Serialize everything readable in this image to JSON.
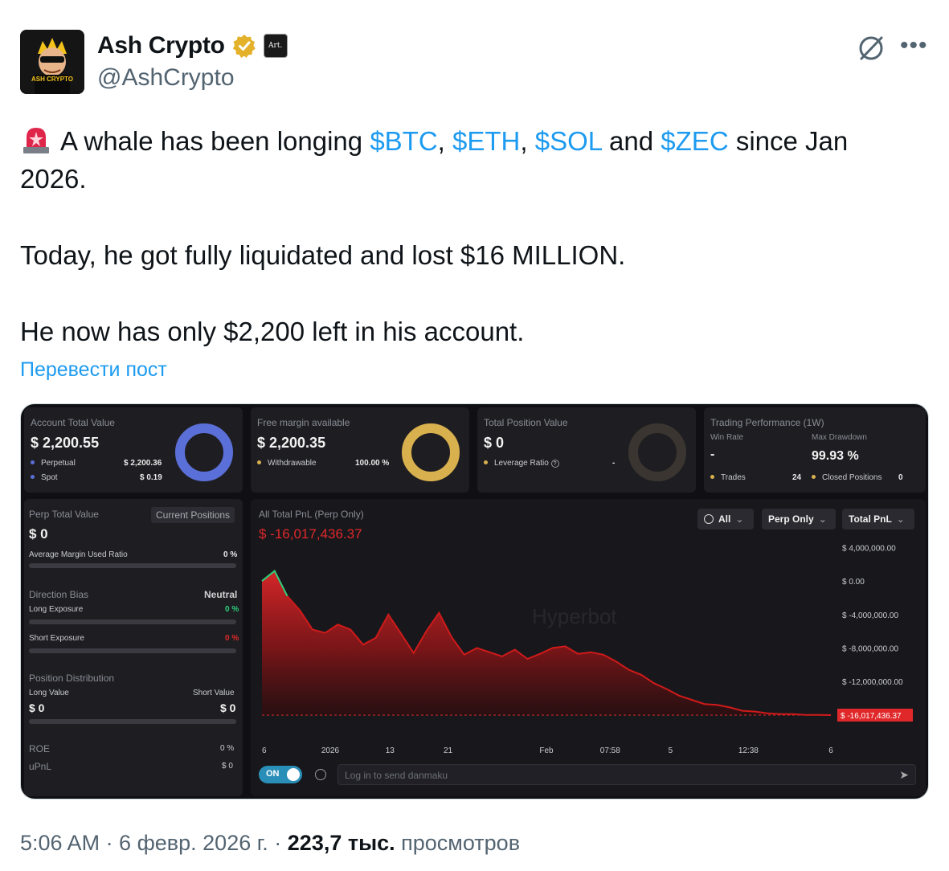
{
  "author": {
    "name": "Ash Crypto",
    "handle": "@AshCrypto",
    "avatar_text": "ASH CRYPTO",
    "affiliate_badge": "Art.",
    "verified_badge_icon": "verified-badge-icon"
  },
  "tweet": {
    "line1_prefix": "A whale has been longing ",
    "tag_btc": "$BTC",
    "sep1": ", ",
    "tag_eth": "$ETH",
    "sep2": ", ",
    "tag_sol": "$SOL",
    "and_text": " and ",
    "tag_zec": "$ZEC",
    "line1_suffix": " since Jan 2026.",
    "para2": "Today, he got fully liquidated and lost $16 MILLION.",
    "para3": "He now has only $2,200 left in his account.",
    "translate_link": "Перевести пост"
  },
  "dashboard": {
    "account": {
      "label": "Account Total Value",
      "value": "$ 2,200.55",
      "perp_label": "Perpetual",
      "perp_value": "$ 2,200.36",
      "spot_label": "Spot",
      "spot_value": "$ 0.19"
    },
    "margin": {
      "label": "Free margin available",
      "value": "$ 2,200.35",
      "withdrawable_label": "Withdrawable",
      "withdrawable_value": "100.00 %"
    },
    "position": {
      "label": "Total Position Value",
      "value": "$ 0",
      "leverage_label": "Leverage Ratio",
      "leverage_value": "-"
    },
    "performance": {
      "label": "Trading Performance (1W)",
      "win_rate_label": "Win Rate",
      "win_rate_value": "-",
      "max_dd_label": "Max Drawdown",
      "max_dd_value": "99.93 %",
      "trades_label": "Trades",
      "trades_value": "24",
      "closed_label": "Closed Positions",
      "closed_value": "0"
    },
    "perp": {
      "label": "Perp Total Value",
      "current_positions_button": "Current Positions",
      "value": "$ 0",
      "avg_margin_label": "Average Margin Used Ratio",
      "avg_margin_value": "0 %",
      "direction_bias_label": "Direction Bias",
      "direction_bias_value": "Neutral",
      "long_exposure_label": "Long Exposure",
      "long_exposure_value": "0 %",
      "short_exposure_label": "Short Exposure",
      "short_exposure_value": "0 %",
      "position_dist_label": "Position Distribution",
      "long_value_label": "Long Value",
      "short_value_label": "Short Value",
      "long_value": "$ 0",
      "short_value": "$ 0",
      "roe_label": "ROE",
      "roe_value": "0 %",
      "upnl_label": "uPnL",
      "upnl_value": "$ 0"
    },
    "pnl": {
      "label": "All Total PnL (Perp Only)",
      "value": "$ -16,017,436.37",
      "filter_all": "All",
      "filter_perp": "Perp Only",
      "filter_total": "Total PnL",
      "watermark": "Hyperbot",
      "danmaku_toggle": "ON",
      "danmaku_placeholder": "Log in to send danmaku"
    },
    "colors": {
      "blue": "#5b6fd8",
      "gold": "#d9b04e",
      "red": "#e0282a",
      "green": "#2bd07a"
    }
  },
  "chart_data": {
    "type": "area",
    "title": "All Total PnL (Perp Only)",
    "x_tick_labels": [
      "6",
      "2026",
      "13",
      "21",
      "Feb",
      "07:58",
      "5",
      "12:38",
      "6"
    ],
    "y_tick_labels": [
      "$ 4,000,000.00",
      "$ 0.00",
      "$ -4,000,000.00",
      "$ -8,000,000.00",
      "$ -12,000,000.00"
    ],
    "ylim": [
      -16500000,
      5000000
    ],
    "last_value_label": "$ -16,017,436.37",
    "series": [
      {
        "values": [
          0,
          1200000,
          -1800000,
          -3500000,
          -5800000,
          -6200000,
          -5200000,
          -5800000,
          -7600000,
          -6800000,
          -4000000,
          -6300000,
          -8600000,
          -6000000,
          -3800000,
          -6700000,
          -8800000,
          -8000000,
          -8500000,
          -9000000,
          -8200000,
          -9300000,
          -8700000,
          -8000000,
          -7800000,
          -8700000,
          -8500000,
          -8800000,
          -9600000,
          -10600000,
          -11200000,
          -12200000,
          -12900000,
          -13700000,
          -14200000,
          -14700000,
          -14800000,
          -15100000,
          -15500000,
          -15600000,
          -15800000,
          -15900000,
          -15900000,
          -16000000,
          -16000000,
          -16017436
        ]
      }
    ]
  },
  "footer": {
    "time": "5:06 AM · 6 февр. 2026 г. · ",
    "views": "223,7 тыс.",
    "views_label": " просмотров"
  }
}
